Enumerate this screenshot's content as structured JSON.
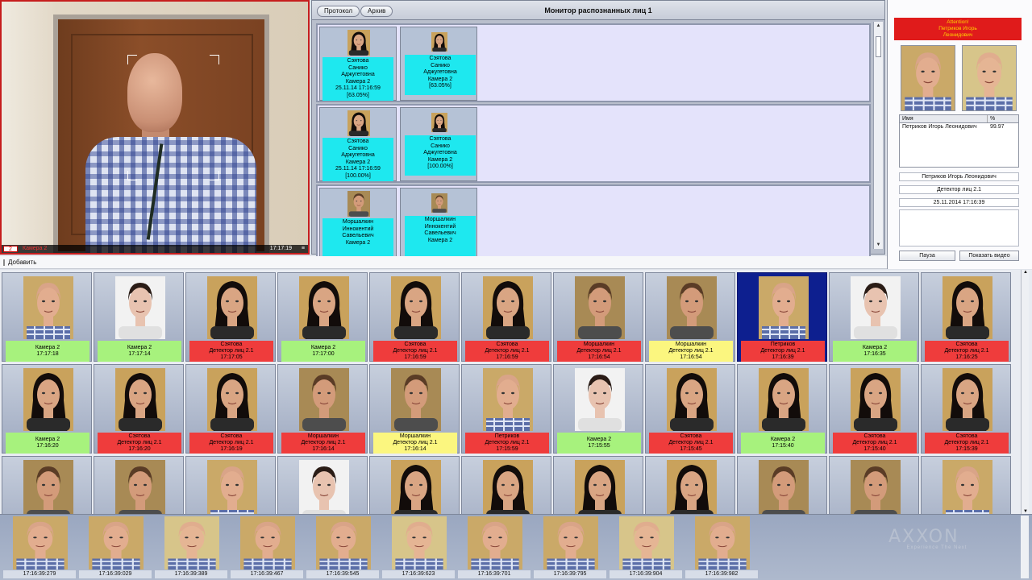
{
  "camera": {
    "number": "2",
    "name": "Камера 2",
    "time": "17:17:19",
    "menu_icon": "hamburger-menu-icon"
  },
  "monitor": {
    "title": "Монитор распознанных лиц 1",
    "buttons": {
      "protocol": "Протокол",
      "archive": "Архив"
    },
    "rows": [
      {
        "type": "f",
        "card1": "Сэятова\nСанико\nАджугетовна\nКамера 2\n25.11.14 17:16:59\n[63.05%]",
        "card2": "Сэятова\nСанико\nАджугетовна\nКамера 2\n[63.05%]"
      },
      {
        "type": "f",
        "card1": "Сэятова\nСанико\nАджугетовна\nКамера 2\n25.11.14 17:16:59\n[100.00%]",
        "card2": "Сэятова\nСанико\nАджугетовна\nКамера 2\n[100.00%]"
      },
      {
        "type": "m2",
        "card1": "Моршалкин\nИннокентий\nСавельевич\nКамера 2",
        "card2": "Моршалкин\nИннокентий\nСавельевич\nКамера 2"
      }
    ]
  },
  "panel": {
    "alert_lines": [
      "Attention!",
      "Петриков Игорь",
      "Леонидович"
    ],
    "table_headers": {
      "name": "Имя",
      "percent": "%"
    },
    "table_rows": [
      {
        "name": "Петриков Игорь Леонидович",
        "percent": "99.97"
      }
    ],
    "name_field": "Петриков Игорь Леонидович",
    "detector_field": "Детектор лиц 2.1",
    "datetime_field": "25.11.2014 17:16:39",
    "pause_button": "Пауза",
    "show_video_button": "Показать видео"
  },
  "toolbar": {
    "add_label": "Добавить"
  },
  "gallery": {
    "colors": {
      "green": "#a7f27d",
      "red": "#ef3c3c",
      "yellow": "#fbf67f",
      "selected": "#0d1f8f"
    },
    "cells": [
      {
        "face": "b",
        "status": "green",
        "text": "Камера 2\n17:17:18"
      },
      {
        "face": "w",
        "status": "green",
        "text": "Камера 2\n17:17:14"
      },
      {
        "face": "f",
        "status": "red",
        "text": "Сэятова\nДетектор лиц 2.1\n17:17:05"
      },
      {
        "face": "f",
        "status": "green",
        "text": "Камера 2\n17:17:00"
      },
      {
        "face": "f",
        "status": "red",
        "text": "Сэятова\nДетектор лиц 2.1\n17:16:59"
      },
      {
        "face": "f",
        "status": "red",
        "text": "Сэятова\nДетектор лиц 2.1\n17:16:59"
      },
      {
        "face": "m2",
        "status": "red",
        "text": "Моршалкин\nДетектор лиц 2.1\n17:16:54"
      },
      {
        "face": "m2",
        "status": "yellow",
        "text": "Моршалкин\nДетектор лиц 2.1\n17:16:54"
      },
      {
        "face": "b",
        "status": "red",
        "text": "Петриков\nДетектор лиц 2.1\n17:16:39",
        "selected": true
      },
      {
        "face": "w",
        "status": "green",
        "text": "Камера 2\n17:16:35"
      },
      {
        "face": "f",
        "status": "red",
        "text": "Сэятова\nДетектор лиц 2.1\n17:16:25"
      },
      {
        "face": "f",
        "status": "green",
        "text": "Камера 2\n17:16:20"
      },
      {
        "face": "f",
        "status": "red",
        "text": "Сэятова\nДетектор лиц 2.1\n17:16:20"
      },
      {
        "face": "f",
        "status": "red",
        "text": "Сэятова\nДетектор лиц 2.1\n17:16:19"
      },
      {
        "face": "m2",
        "status": "red",
        "text": "Моршалкин\nДетектор лиц 2.1\n17:16:14"
      },
      {
        "face": "m2",
        "status": "yellow",
        "text": "Моршалкин\nДетектор лиц 2.1\n17:16:14"
      },
      {
        "face": "b",
        "status": "red",
        "text": "Петриков\nДетектор лиц 2.1\n17:15:59"
      },
      {
        "face": "w",
        "status": "green",
        "text": "Камера 2\n17:15:55"
      },
      {
        "face": "f",
        "status": "red",
        "text": "Сэятова\nДетектор лиц 2.1\n17:15:45"
      },
      {
        "face": "f",
        "status": "green",
        "text": "Камера 2\n17:15:40"
      },
      {
        "face": "f",
        "status": "red",
        "text": "Сэятова\nДетектор лиц 2.1\n17:15:40"
      },
      {
        "face": "f",
        "status": "red",
        "text": "Сэятова\nДетектор лиц 2.1\n17:15:39"
      },
      {
        "face": "m2",
        "status": "none",
        "text": ""
      },
      {
        "face": "m2",
        "status": "none",
        "text": ""
      },
      {
        "face": "b",
        "status": "none",
        "text": ""
      },
      {
        "face": "w",
        "status": "none",
        "text": ""
      },
      {
        "face": "f",
        "status": "none",
        "text": ""
      },
      {
        "face": "f",
        "status": "none",
        "text": ""
      },
      {
        "face": "f",
        "status": "none",
        "text": ""
      },
      {
        "face": "f",
        "status": "none",
        "text": ""
      },
      {
        "face": "m2",
        "status": "none",
        "text": ""
      },
      {
        "face": "m2",
        "status": "none",
        "text": ""
      },
      {
        "face": "b",
        "status": "none",
        "text": ""
      }
    ]
  },
  "strip": {
    "items": [
      "17:16:39:279",
      "17:16:39:029",
      "17:16:39:389",
      "17:16:39:467",
      "17:16:39:545",
      "17:16:39:623",
      "17:16:39:701",
      "17:16:39:795",
      "17:16:39:904",
      "17:16:39:982"
    ]
  },
  "logo": {
    "word": "AXXON",
    "tagline": "Experience The Next"
  }
}
